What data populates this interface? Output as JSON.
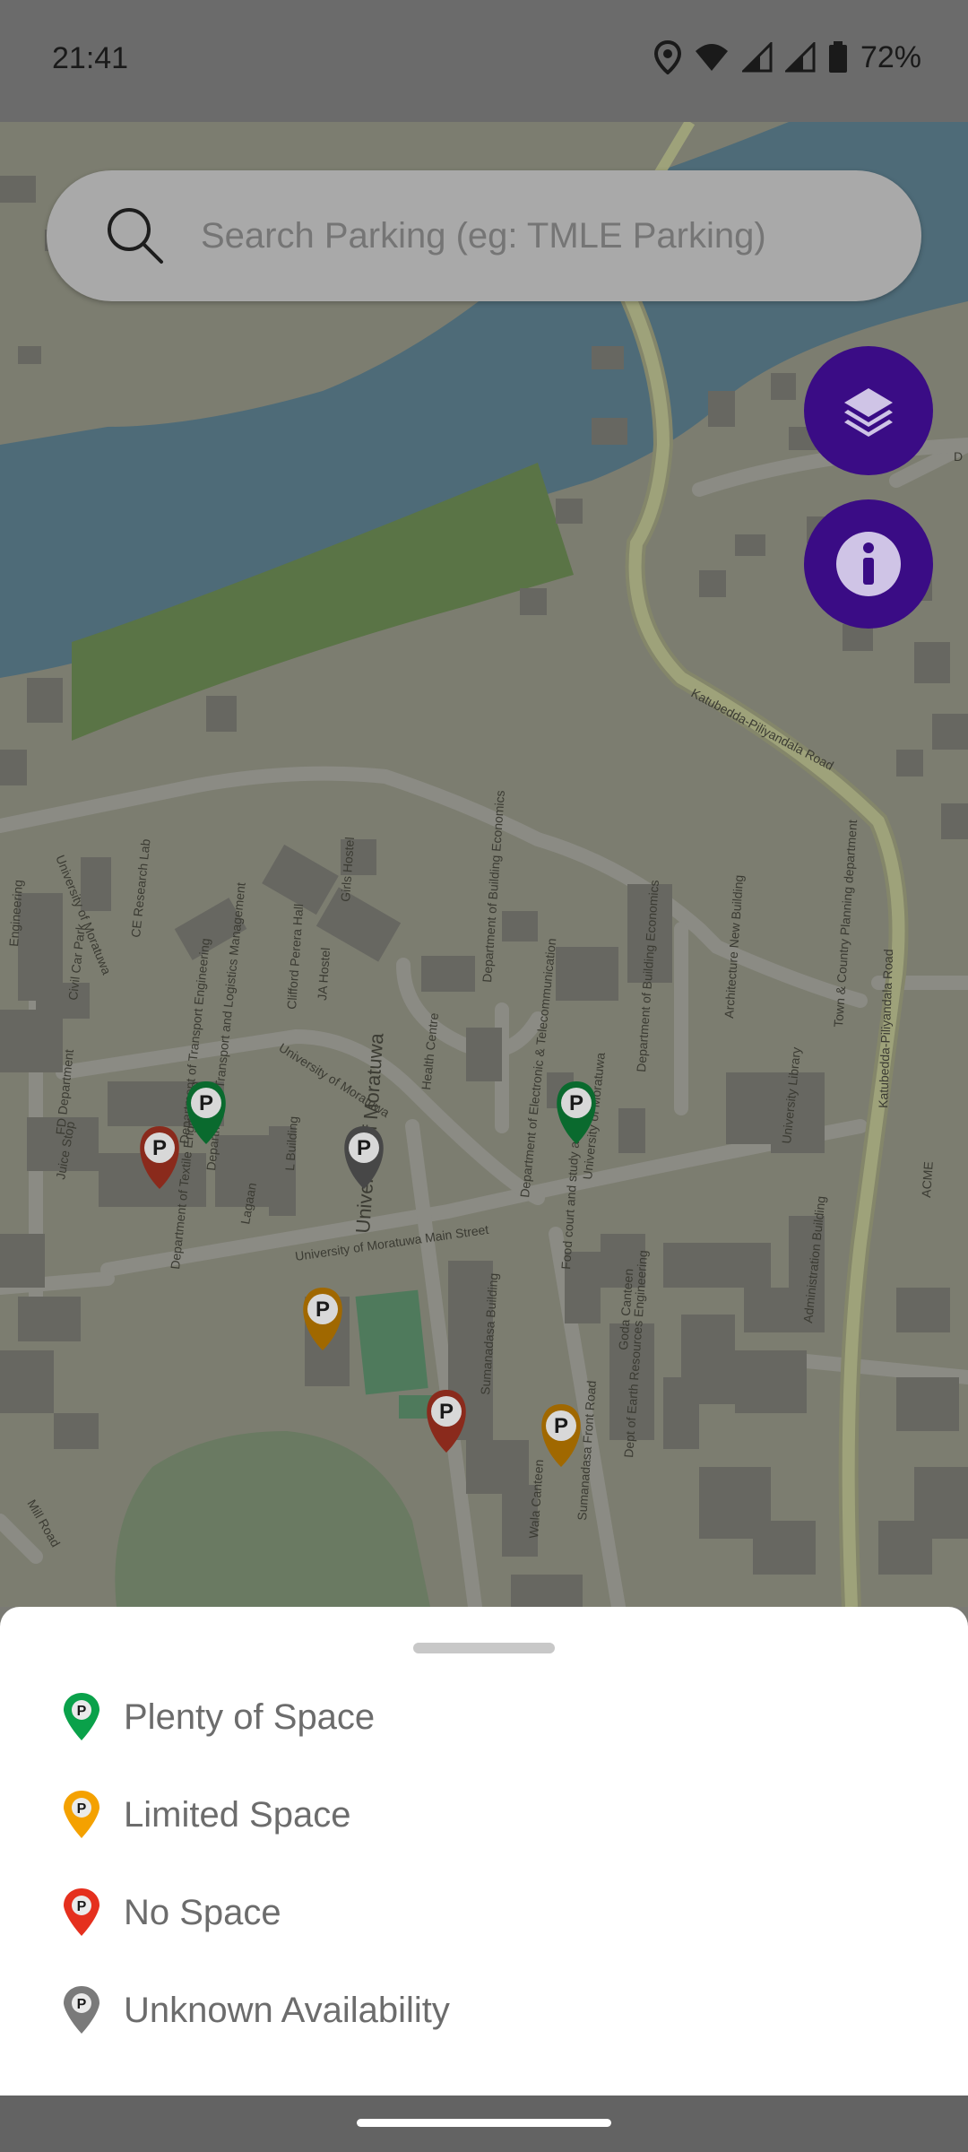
{
  "status_bar": {
    "time": "21:41",
    "battery": "72%",
    "icons": [
      "location-icon",
      "wifi-icon",
      "signal-icon",
      "signal-icon",
      "battery-icon"
    ]
  },
  "search": {
    "placeholder": "Search Parking (eg: TMLE Parking)",
    "icon": "search-icon"
  },
  "fabs": [
    {
      "name": "layers",
      "icon": "layers-icon",
      "color": "#3a0c85"
    },
    {
      "name": "info",
      "icon": "info-icon",
      "color": "#3a0c85"
    }
  ],
  "map": {
    "labels": {
      "katubedda_road_1": "Katubedda-Piliyandala Road",
      "katubedda_road_2": "Katubedda-Piliyandala Road",
      "university": "University of Moratuwa",
      "univ_moratuwa_road_1": "University of Moratuwa",
      "univ_moratuwa_road_2": "University of Moratuwa",
      "univ_moratuwa_road_3": "University of Moratuwa",
      "main_street": "University of Moratuwa Main Street",
      "sumanadasa_front_road": "Sumanadasa Front Road",
      "mill_road": "Mill Road",
      "sumanadasa_building": "Sumanadasa Building",
      "administration": "Administration Building",
      "university_library": "University Library",
      "health_centre": "Health Centre",
      "department_transport": "Department of Transport Engineering",
      "department_textile": "Department of Textile Engineering",
      "department_electronic": "Department of Electronic & Telecommunication",
      "department_building_economics": "Department of Building Economics",
      "department_building": "Department of Building Economics",
      "department_town": "Town & Country Planning department",
      "architecture": "Architecture New Building",
      "fd_department": "FD Department",
      "civil_car_park": "Civil Car Park",
      "ce_research_lab": "CE Research Lab",
      "girls_hostel": "Girls Hostel",
      "clifford_perera_hall": "Clifford Perera Hall",
      "ja_hostel": "JA Hostel",
      "l_building": "L Building",
      "juice_stop": "Juice Stop",
      "lagaan": "Lagaan",
      "food_court": "Food court and study area",
      "goda_canteen": "Goda Canteen",
      "wala_canteen": "Wala Canteen",
      "dept_earth": "Dept of Earth Resources Engineering",
      "transport_logistics": "Department of Transport and Logistics Management",
      "acme": "ACME",
      "engineering": "Engineering",
      "d_road": "D"
    },
    "pins": [
      {
        "status": "plenty",
        "color": "#0a8a3a"
      },
      {
        "status": "none",
        "color": "#b3261e"
      },
      {
        "status": "unknown",
        "color": "#555555"
      },
      {
        "status": "plenty",
        "color": "#0a8a3a"
      },
      {
        "status": "limited",
        "color": "#d08a00"
      },
      {
        "status": "none",
        "color": "#b3261e"
      },
      {
        "status": "limited",
        "color": "#d08a00"
      }
    ]
  },
  "legend": {
    "items": [
      {
        "label": "Plenty of Space",
        "color": "#0aa14a",
        "icon": "green-parking-pin-icon"
      },
      {
        "label": "Limited Space",
        "color": "#f4a100",
        "icon": "orange-parking-pin-icon"
      },
      {
        "label": "No Space",
        "color": "#e5301e",
        "icon": "red-parking-pin-icon"
      },
      {
        "label": "Unknown Availability",
        "color": "#7a7a7a",
        "icon": "gray-parking-pin-icon"
      }
    ]
  }
}
